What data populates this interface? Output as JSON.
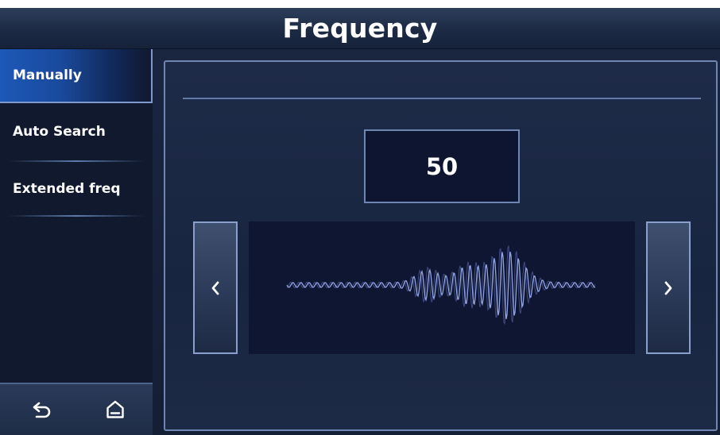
{
  "header": {
    "title": "Frequency"
  },
  "sidebar": {
    "items": [
      {
        "label": "Manually",
        "active": true
      },
      {
        "label": "Auto Search",
        "active": false
      },
      {
        "label": "Extended freq",
        "active": false
      }
    ],
    "bottom": {
      "back_icon": "back-arrow-icon",
      "home_icon": "home-icon"
    }
  },
  "main": {
    "frequency_value": "50",
    "prev_icon": "chevron-left-icon",
    "next_icon": "chevron-right-icon",
    "wave_icon": "waveform-icon"
  },
  "colors": {
    "accent": "#1c58b8",
    "panel_border": "#6f85b2",
    "background": "#141e34",
    "wave": "#8fa0dc"
  }
}
